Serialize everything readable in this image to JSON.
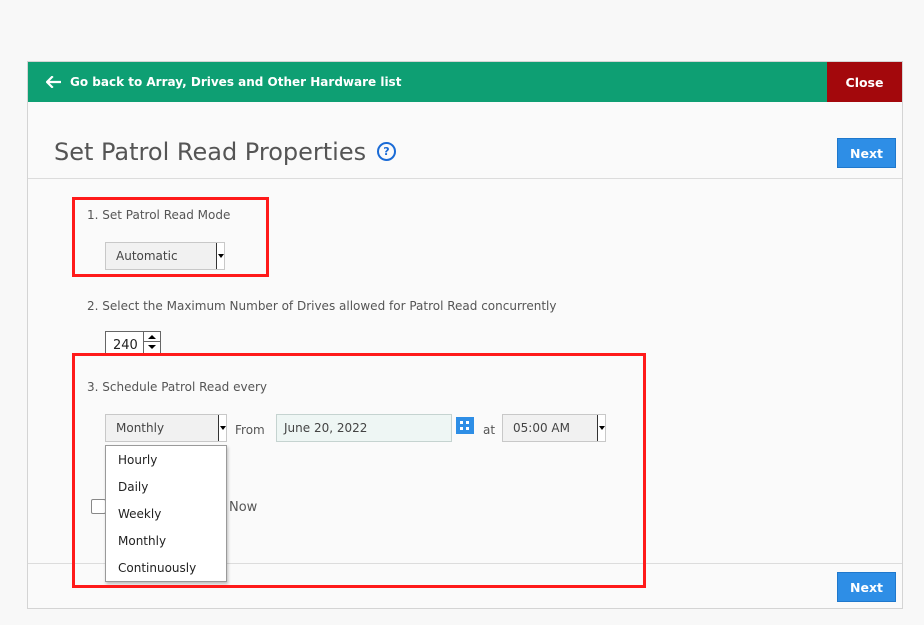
{
  "topbar": {
    "back_label": "Go back to Array, Drives and Other Hardware list",
    "close_label": "Close",
    "color": "#0e9f73",
    "close_color": "#a3080c"
  },
  "header": {
    "title": "Set Patrol Read Properties",
    "help_glyph": "?",
    "next_label": "Next"
  },
  "section1": {
    "label": "1. Set Patrol Read Mode",
    "mode_value": "Automatic"
  },
  "section2": {
    "label": "2. Select the Maximum Number of Drives allowed for Patrol Read concurrently",
    "drives_value": "240"
  },
  "section3": {
    "label": "3. Schedule Patrol Read every",
    "frequency_value": "Monthly",
    "from_label": "From",
    "date_value": "June 20, 2022",
    "at_label": "at",
    "time_value": "05:00 AM",
    "frequency_options": [
      "Hourly",
      "Daily",
      "Weekly",
      "Monthly",
      "Continuously"
    ]
  },
  "start_now": {
    "label": "Now"
  },
  "footer": {
    "next_label": "Next"
  },
  "accent": {
    "button_blue": "#2e8ee6",
    "highlight_red": "#ff1a1a"
  },
  "icons": [
    "arrow-left-icon",
    "help-icon",
    "calendar-icon",
    "chevron-down-icon"
  ]
}
